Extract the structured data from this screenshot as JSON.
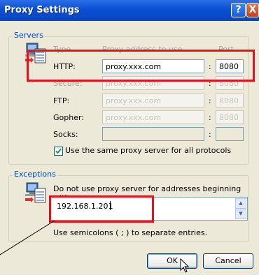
{
  "window": {
    "title": "Proxy Settings",
    "help_button": "?",
    "close_button": "X"
  },
  "servers": {
    "legend": "Servers",
    "col_type": "Type",
    "col_address": "Proxy address to use",
    "col_port": "Port",
    "rows": [
      {
        "type": "HTTP:",
        "address": "proxy.xxx.com",
        "port": "8080",
        "enabled": true
      },
      {
        "type": "Secure:",
        "address": "proxy.xxx.com",
        "port": "8080",
        "enabled": false
      },
      {
        "type": "FTP:",
        "address": "proxy.xxx.com",
        "port": "8080",
        "enabled": false
      },
      {
        "type": "Gopher:",
        "address": "proxy.xxx.com",
        "port": "8080",
        "enabled": false
      },
      {
        "type": "Socks:",
        "address": "",
        "port": "",
        "enabled": true
      }
    ],
    "separator": ":",
    "same_proxy_label": "Use the same proxy server for all protocols",
    "same_proxy_checked": true
  },
  "exceptions": {
    "legend": "Exceptions",
    "description": "Do not use proxy server for addresses beginning with:",
    "value": "192.168.1.201",
    "hint": "Use semicolons ( ; ) to separate entries."
  },
  "buttons": {
    "ok": "OK",
    "cancel": "Cancel"
  },
  "colors": {
    "highlight": "#e8101c",
    "legend_text": "#0046d5",
    "title_bar": "#0a4fd3"
  },
  "icons": [
    "network-computer-icon",
    "exceptions-computer-icon",
    "checkmark-icon",
    "mouse-cursor-icon"
  ]
}
